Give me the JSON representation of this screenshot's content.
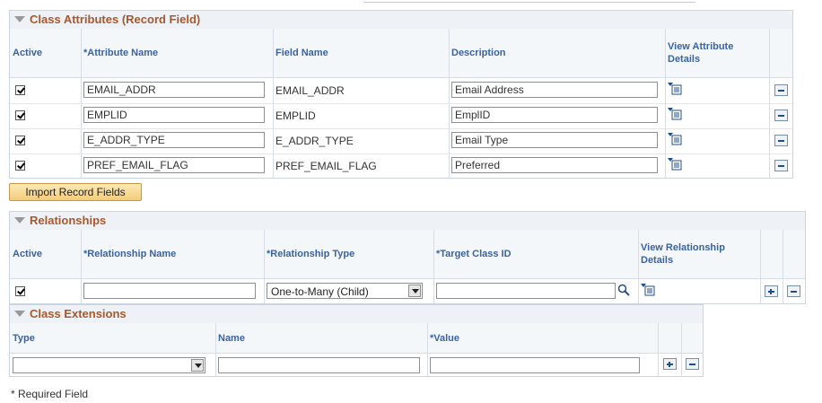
{
  "attributes": {
    "title": "Class Attributes (Record Field)",
    "headers": {
      "active": "Active",
      "attribute_name": "*Attribute Name",
      "field_name": "Field Name",
      "description": "Description",
      "view_details_1": "View Attribute",
      "view_details_2": "Details"
    },
    "rows": [
      {
        "attribute_name": "EMAIL_ADDR",
        "field_name": "EMAIL_ADDR",
        "description": "Email Address"
      },
      {
        "attribute_name": "EMPLID",
        "field_name": "EMPLID",
        "description": "EmplID"
      },
      {
        "attribute_name": "E_ADDR_TYPE",
        "field_name": "E_ADDR_TYPE",
        "description": "Email Type"
      },
      {
        "attribute_name": "PREF_EMAIL_FLAG",
        "field_name": "PREF_EMAIL_FLAG",
        "description": "Preferred"
      }
    ],
    "import_button": "Import Record Fields"
  },
  "relationships": {
    "title": "Relationships",
    "headers": {
      "active": "Active",
      "relationship_name": "*Relationship Name",
      "relationship_type": "*Relationship Type",
      "target_class": "*Target Class ID",
      "view_details_1": "View Relationship",
      "view_details_2": "Details"
    },
    "row": {
      "relationship_name": "",
      "relationship_type": "One-to-Many (Child)",
      "target_class": ""
    }
  },
  "extensions": {
    "title": "Class Extensions",
    "headers": {
      "type": "Type",
      "name": "Name",
      "value": "*Value"
    },
    "row": {
      "type": "",
      "name": "",
      "value": ""
    }
  },
  "footer": {
    "required_note": "* Required Field"
  },
  "icons": {
    "details": "view-details-icon",
    "delete": "delete-row-icon",
    "add": "add-row-icon",
    "lookup": "lookup-icon"
  }
}
